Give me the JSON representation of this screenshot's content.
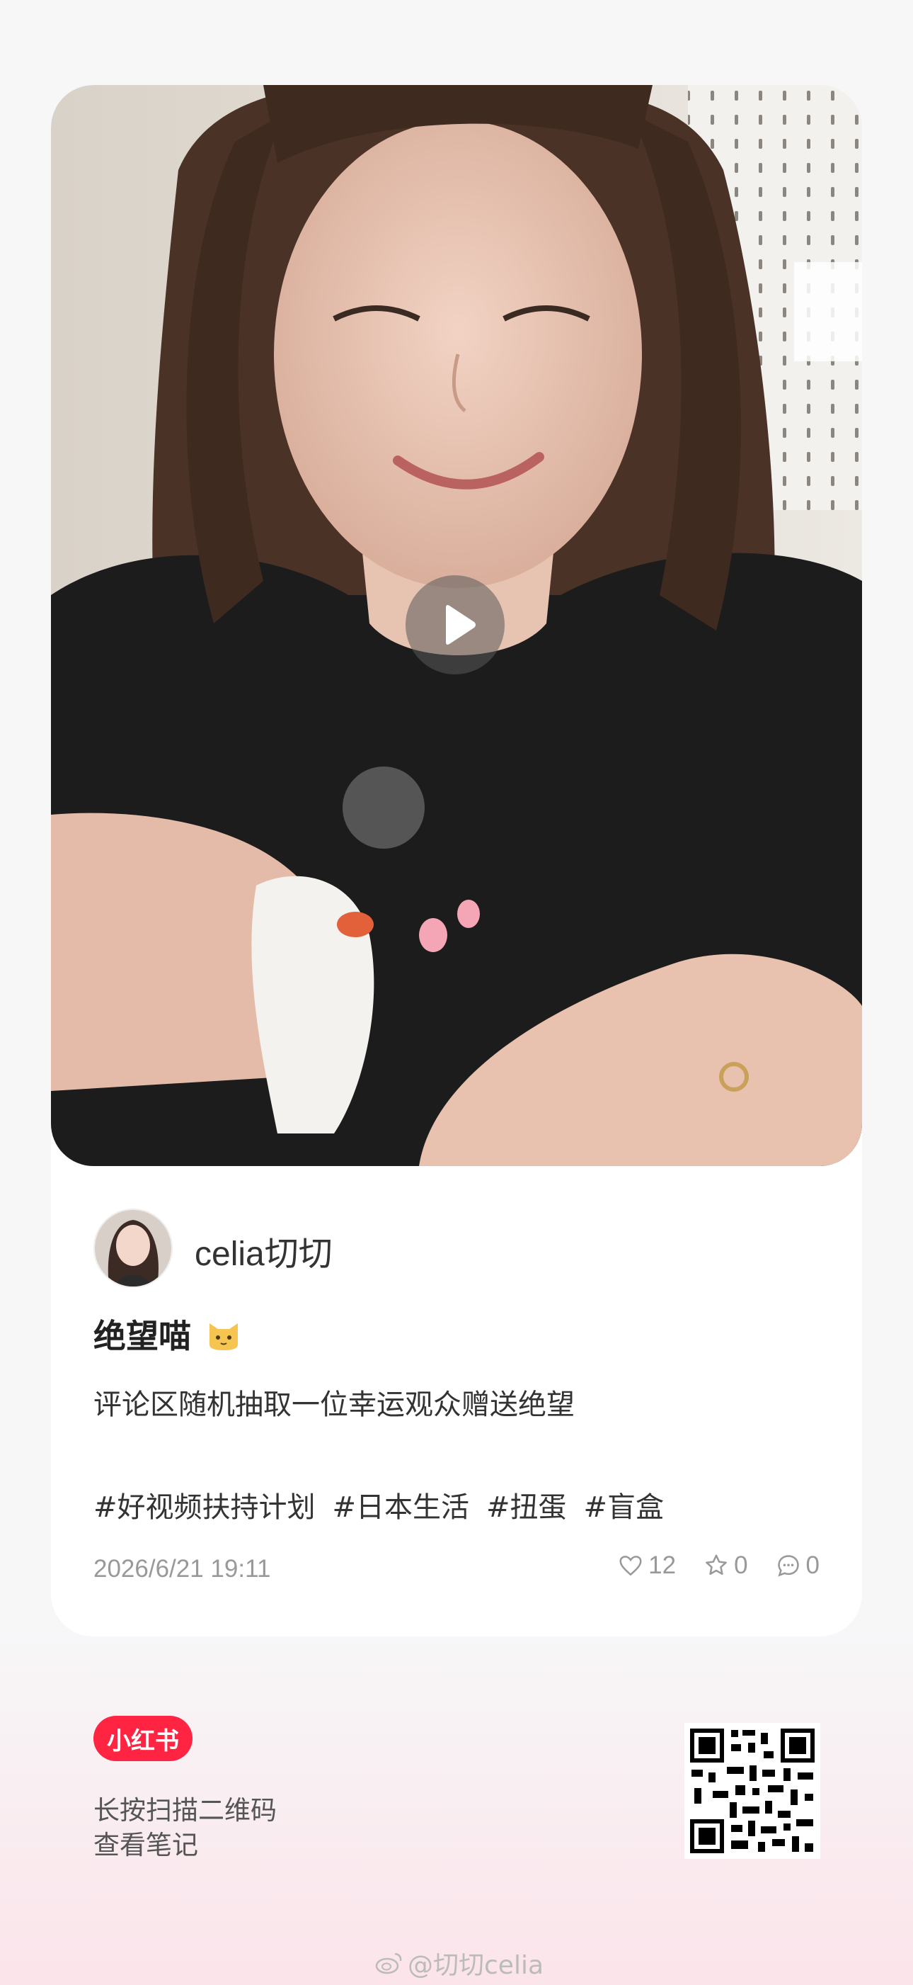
{
  "author": {
    "name": "celia切切"
  },
  "post": {
    "title": "绝望喵",
    "description": "评论区随机抽取一位幸运观众赠送绝望",
    "tags": [
      "#好视频扶持计划",
      "#日本生活",
      "#扭蛋",
      "#盲盒"
    ],
    "date": "2026/6/21 19:11",
    "likes": "12",
    "favorites": "0",
    "comments": "0"
  },
  "footer": {
    "app_logo": "小红书",
    "scan_line1": "长按扫描二维码",
    "scan_line2": "查看笔记",
    "watermark": "@切切celia"
  },
  "colors": {
    "brand": "#ff2442",
    "muted": "#999999"
  }
}
